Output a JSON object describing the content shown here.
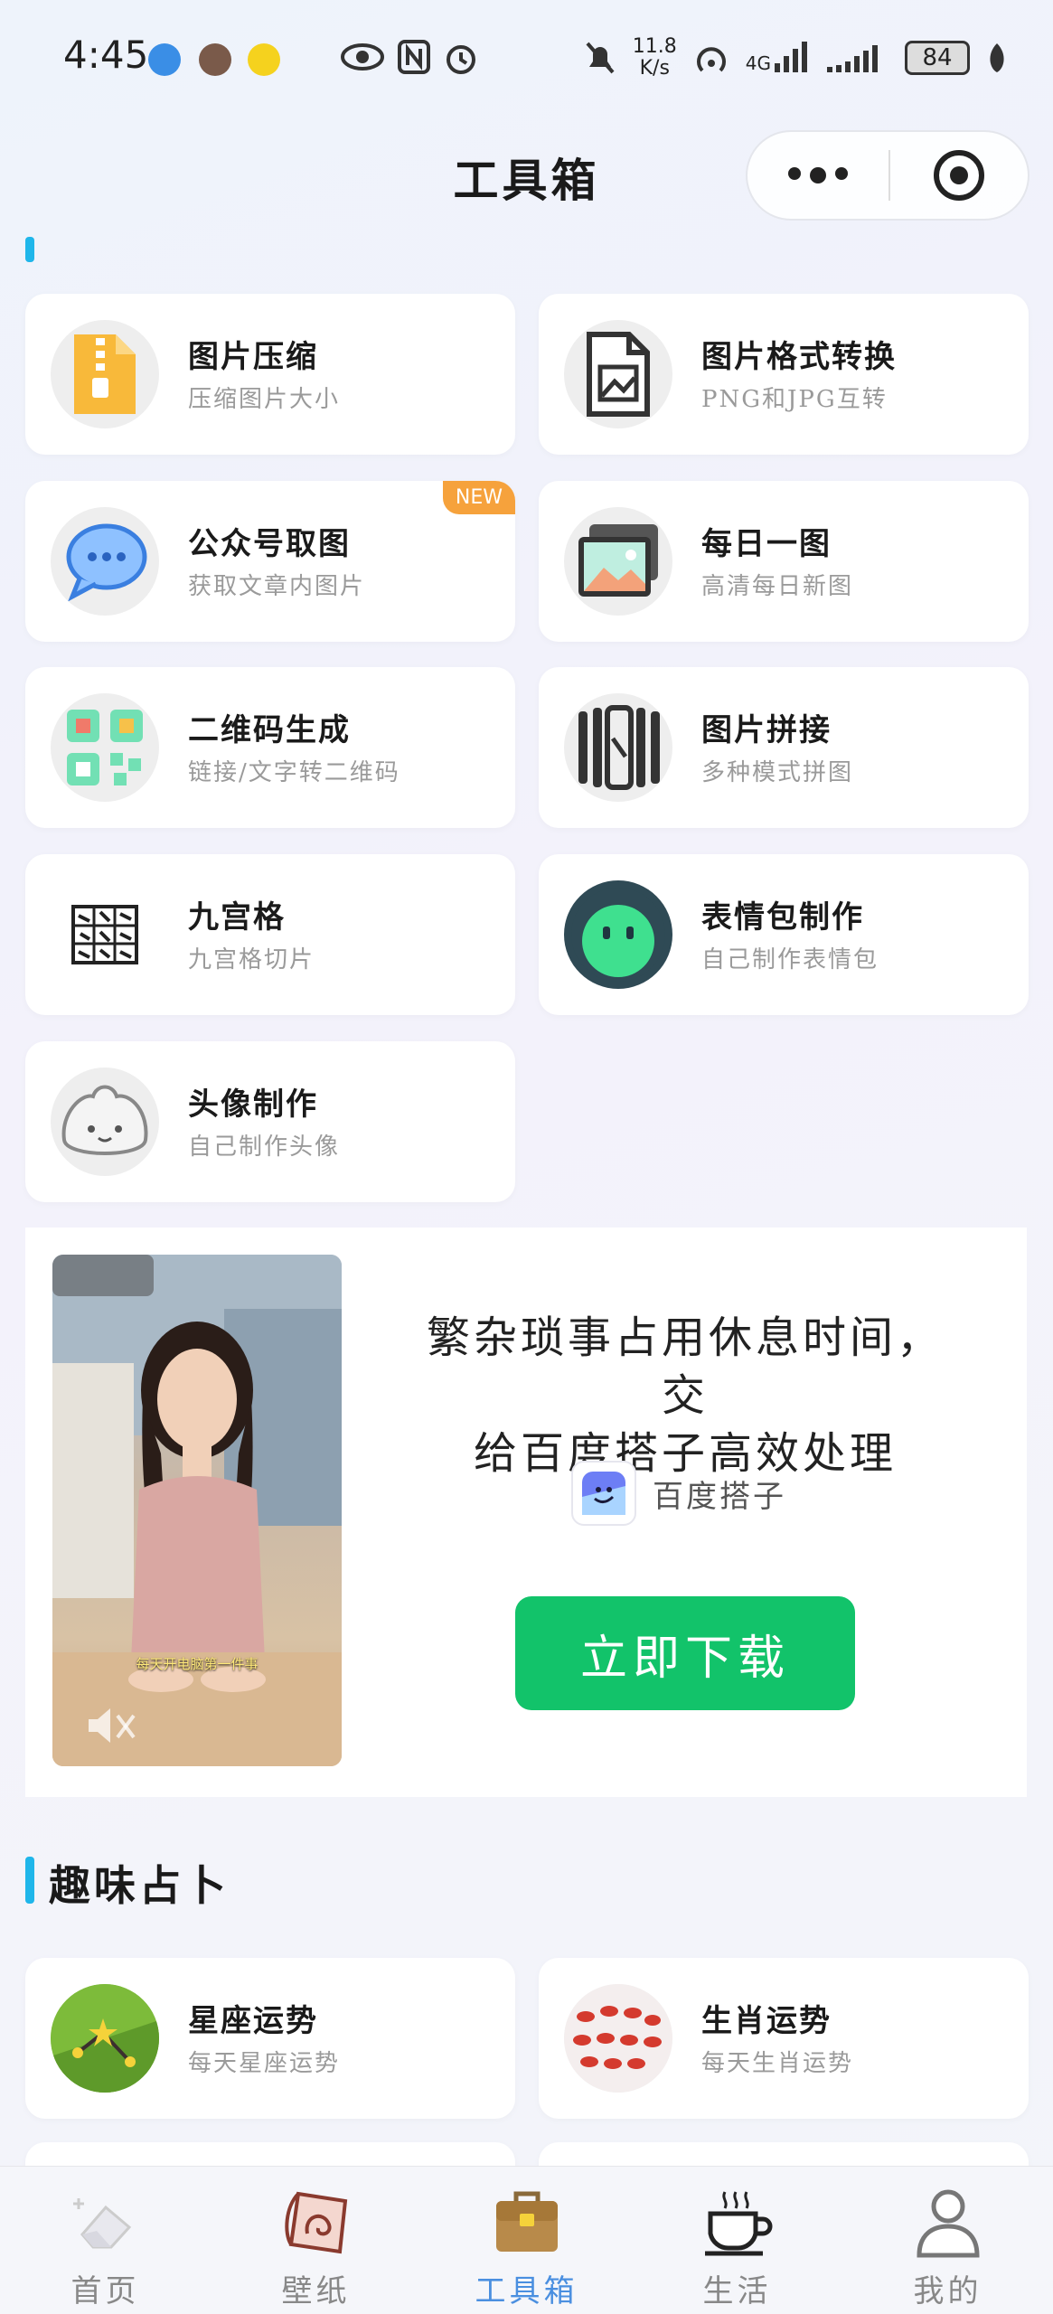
{
  "status_bar": {
    "time": "4:45",
    "speed_value": "11.8",
    "speed_unit": "K/s",
    "network": "4G",
    "battery": "84"
  },
  "navbar": {
    "title": "工具箱"
  },
  "tools": [
    {
      "title": "图片压缩",
      "subtitle": "压缩图片大小",
      "icon": "zip-file-icon"
    },
    {
      "title": "图片格式转换",
      "subtitle": "PNG和JPG互转",
      "icon": "image-file-icon"
    },
    {
      "title": "公众号取图",
      "subtitle": "获取文章内图片",
      "icon": "chat-bubble-icon",
      "badge": "NEW"
    },
    {
      "title": "每日一图",
      "subtitle": "高清每日新图",
      "icon": "gallery-icon"
    },
    {
      "title": "二维码生成",
      "subtitle": "链接/文字转二维码",
      "icon": "qr-code-icon"
    },
    {
      "title": "图片拼接",
      "subtitle": "多种模式拼图",
      "icon": "collage-icon"
    },
    {
      "title": "九宫格",
      "subtitle": "九宫格切片",
      "icon": "grid-icon"
    },
    {
      "title": "表情包制作",
      "subtitle": "自己制作表情包",
      "icon": "emoji-face-icon"
    },
    {
      "title": "头像制作",
      "subtitle": "自己制作头像",
      "icon": "avatar-bun-icon"
    }
  ],
  "ad": {
    "text_line1": "繁杂琐事占用休息时间，交",
    "text_line2": "给百度搭子高效处理",
    "brand": "百度搭子",
    "button": "立即下载",
    "photo_caption": "每天开电脑第一件事"
  },
  "fortune_section": {
    "title": "趣味占卜",
    "items": [
      {
        "title": "星座运势",
        "subtitle": "每天星座运势",
        "icon": "constellation-icon"
      },
      {
        "title": "生肖运势",
        "subtitle": "每天生肖运势",
        "icon": "zodiac-animals-icon"
      }
    ]
  },
  "tabbar": {
    "tabs": [
      {
        "label": "首页",
        "icon": "eraser-icon"
      },
      {
        "label": "壁纸",
        "icon": "wallpaper-icon"
      },
      {
        "label": "工具箱",
        "icon": "toolbox-icon",
        "active": true
      },
      {
        "label": "生活",
        "icon": "coffee-cup-icon"
      },
      {
        "label": "我的",
        "icon": "user-icon"
      }
    ]
  },
  "colors": {
    "accent": "#1fb6ea",
    "active_tab": "#4a8fe0",
    "download_button": "#12c36a",
    "new_badge": "#f6a23c"
  }
}
